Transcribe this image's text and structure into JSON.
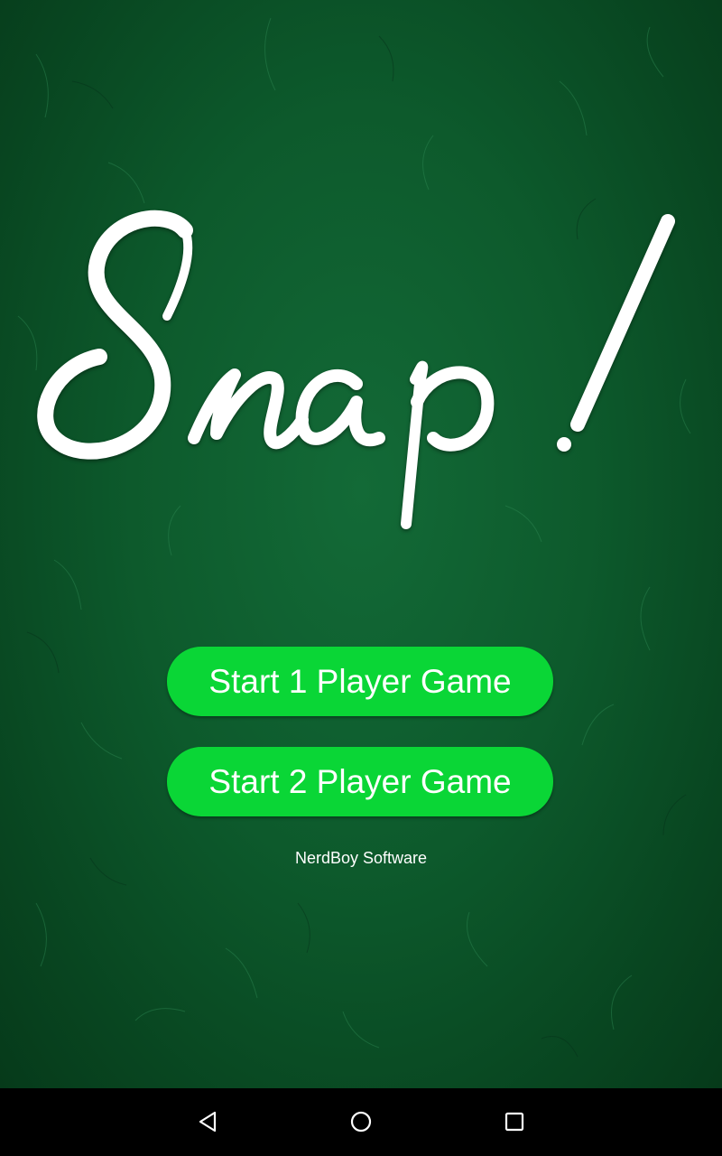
{
  "app": {
    "title": "Snap!"
  },
  "menu": {
    "one_player_label": "Start 1 Player Game",
    "two_player_label": "Start 2 Player Game"
  },
  "footer": {
    "credit": "NerdBoy Software"
  },
  "navbar": {
    "back_icon": "back-triangle-icon",
    "home_icon": "home-circle-icon",
    "recents_icon": "recents-square-icon"
  },
  "colors": {
    "felt": "#0d5a2c",
    "button": "#0ad636",
    "text": "#ffffff",
    "navbar": "#000000"
  }
}
